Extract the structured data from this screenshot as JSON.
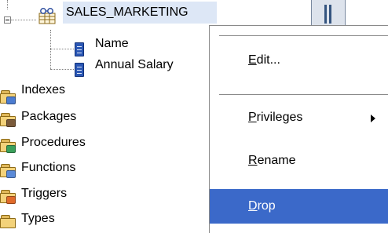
{
  "tree": {
    "table_node": {
      "label": "SALES_MARKETING",
      "icon": "table-icon"
    },
    "columns": [
      {
        "label": "Name",
        "icon": "column-icon"
      },
      {
        "label": "Annual Salary",
        "icon": "column-icon"
      }
    ],
    "folders": [
      {
        "label": "Indexes",
        "icon": "indexes-folder-icon"
      },
      {
        "label": "Packages",
        "icon": "packages-folder-icon"
      },
      {
        "label": "Procedures",
        "icon": "procedures-folder-icon"
      },
      {
        "label": "Functions",
        "icon": "functions-folder-icon"
      },
      {
        "label": "Triggers",
        "icon": "triggers-folder-icon"
      },
      {
        "label": "Types",
        "icon": "types-folder-icon"
      }
    ]
  },
  "context_menu": {
    "items": [
      {
        "mnemonic": "E",
        "rest": "dit..."
      },
      {
        "mnemonic": "P",
        "rest": "rivileges",
        "has_submenu": true
      },
      {
        "mnemonic": "R",
        "rest": "ename"
      },
      {
        "mnemonic": "D",
        "rest": "rop",
        "highlighted": true
      }
    ]
  },
  "colors": {
    "menu_highlight": "#3b69c9",
    "selection": "#dde7f6",
    "folder": "#f3d27a"
  }
}
